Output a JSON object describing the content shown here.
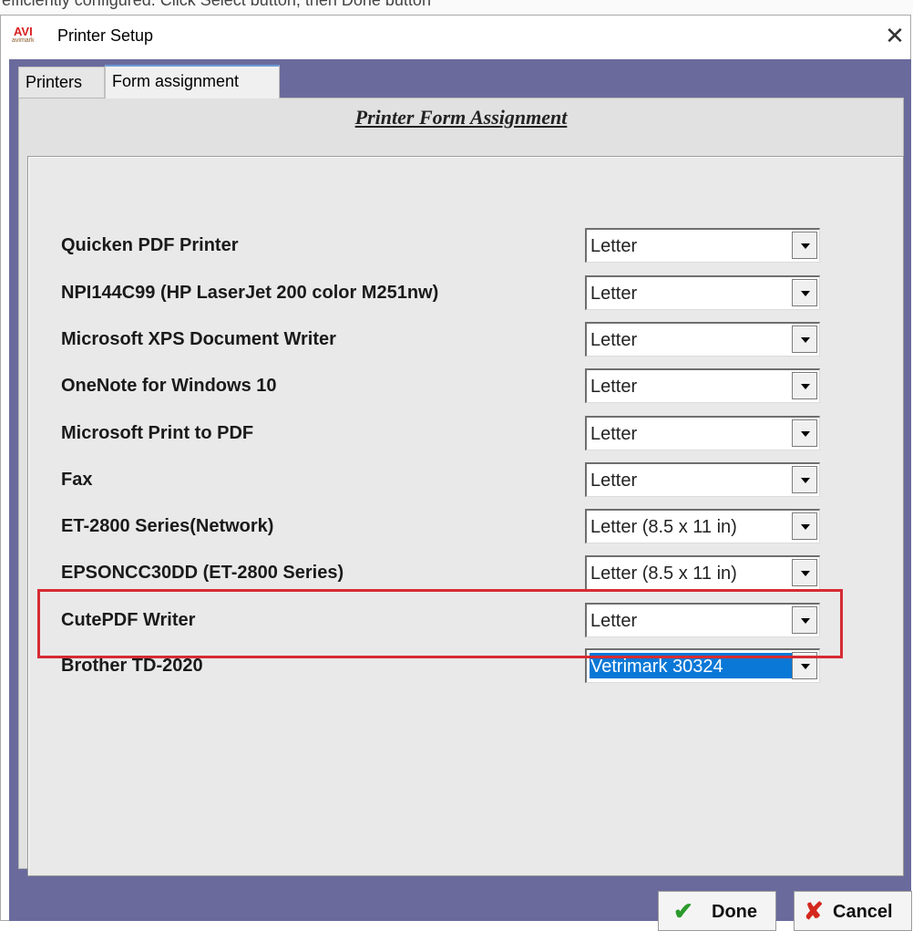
{
  "top_strip_text": "efficiently configured. Click Select button, then Done button",
  "window": {
    "title": "Printer Setup",
    "app_icon_text": "AVI",
    "app_icon_subtext": "avimark"
  },
  "tabs": [
    {
      "label": "Printers",
      "active": false
    },
    {
      "label": "Form assignment",
      "active": true
    }
  ],
  "panel_title": "Printer Form Assignment",
  "printers": [
    {
      "name": "Quicken PDF Printer",
      "form": "Letter"
    },
    {
      "name": "NPI144C99 (HP LaserJet 200 color M251nw)",
      "form": "Letter"
    },
    {
      "name": "Microsoft XPS Document Writer",
      "form": "Letter"
    },
    {
      "name": "OneNote for Windows 10",
      "form": "Letter"
    },
    {
      "name": "Microsoft Print to PDF",
      "form": "Letter"
    },
    {
      "name": "Fax",
      "form": "Letter"
    },
    {
      "name": "ET-2800 Series(Network)",
      "form": "Letter (8.5 x 11 in)"
    },
    {
      "name": "EPSONCC30DD (ET-2800 Series)",
      "form": "Letter (8.5 x 11 in)"
    },
    {
      "name": "CutePDF Writer",
      "form": "Letter"
    },
    {
      "name": "Brother TD-2020",
      "form": "Vetrimark 30324",
      "selected": true
    }
  ],
  "buttons": {
    "done": "Done",
    "cancel": "Cancel"
  },
  "colors": {
    "frame_bg": "#6a6a9c",
    "highlight_border": "#d62b33",
    "selection_bg": "#0a78d7",
    "done_icon": "#2b9a2b",
    "cancel_icon": "#d4281e"
  },
  "icons": {
    "close": "close-icon",
    "done": "checkmark-icon",
    "cancel": "x-icon",
    "dropdown": "chevron-down-icon"
  }
}
